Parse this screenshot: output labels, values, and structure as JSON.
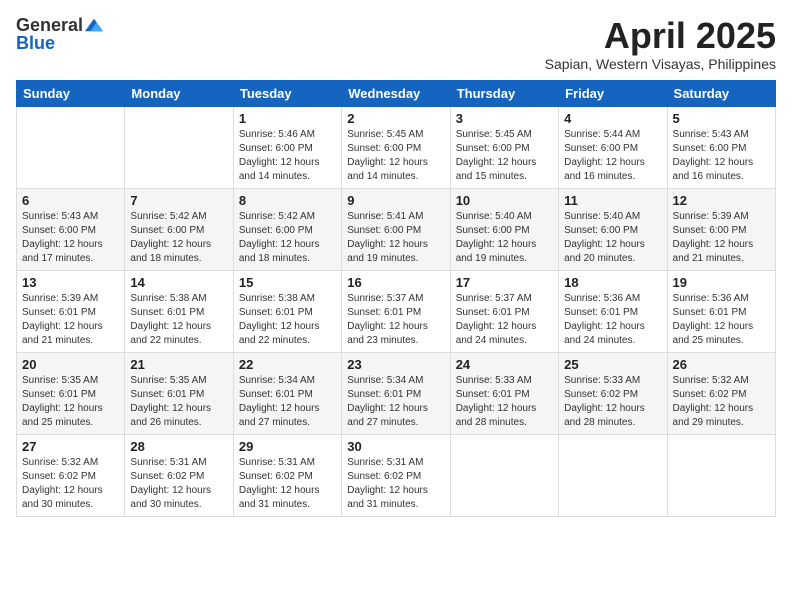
{
  "header": {
    "logo_general": "General",
    "logo_blue": "Blue",
    "month_title": "April 2025",
    "location": "Sapian, Western Visayas, Philippines"
  },
  "weekdays": [
    "Sunday",
    "Monday",
    "Tuesday",
    "Wednesday",
    "Thursday",
    "Friday",
    "Saturday"
  ],
  "weeks": [
    [
      {
        "day": "",
        "sunrise": "",
        "sunset": "",
        "daylight": ""
      },
      {
        "day": "",
        "sunrise": "",
        "sunset": "",
        "daylight": ""
      },
      {
        "day": "1",
        "sunrise": "Sunrise: 5:46 AM",
        "sunset": "Sunset: 6:00 PM",
        "daylight": "Daylight: 12 hours and 14 minutes."
      },
      {
        "day": "2",
        "sunrise": "Sunrise: 5:45 AM",
        "sunset": "Sunset: 6:00 PM",
        "daylight": "Daylight: 12 hours and 14 minutes."
      },
      {
        "day": "3",
        "sunrise": "Sunrise: 5:45 AM",
        "sunset": "Sunset: 6:00 PM",
        "daylight": "Daylight: 12 hours and 15 minutes."
      },
      {
        "day": "4",
        "sunrise": "Sunrise: 5:44 AM",
        "sunset": "Sunset: 6:00 PM",
        "daylight": "Daylight: 12 hours and 16 minutes."
      },
      {
        "day": "5",
        "sunrise": "Sunrise: 5:43 AM",
        "sunset": "Sunset: 6:00 PM",
        "daylight": "Daylight: 12 hours and 16 minutes."
      }
    ],
    [
      {
        "day": "6",
        "sunrise": "Sunrise: 5:43 AM",
        "sunset": "Sunset: 6:00 PM",
        "daylight": "Daylight: 12 hours and 17 minutes."
      },
      {
        "day": "7",
        "sunrise": "Sunrise: 5:42 AM",
        "sunset": "Sunset: 6:00 PM",
        "daylight": "Daylight: 12 hours and 18 minutes."
      },
      {
        "day": "8",
        "sunrise": "Sunrise: 5:42 AM",
        "sunset": "Sunset: 6:00 PM",
        "daylight": "Daylight: 12 hours and 18 minutes."
      },
      {
        "day": "9",
        "sunrise": "Sunrise: 5:41 AM",
        "sunset": "Sunset: 6:00 PM",
        "daylight": "Daylight: 12 hours and 19 minutes."
      },
      {
        "day": "10",
        "sunrise": "Sunrise: 5:40 AM",
        "sunset": "Sunset: 6:00 PM",
        "daylight": "Daylight: 12 hours and 19 minutes."
      },
      {
        "day": "11",
        "sunrise": "Sunrise: 5:40 AM",
        "sunset": "Sunset: 6:00 PM",
        "daylight": "Daylight: 12 hours and 20 minutes."
      },
      {
        "day": "12",
        "sunrise": "Sunrise: 5:39 AM",
        "sunset": "Sunset: 6:00 PM",
        "daylight": "Daylight: 12 hours and 21 minutes."
      }
    ],
    [
      {
        "day": "13",
        "sunrise": "Sunrise: 5:39 AM",
        "sunset": "Sunset: 6:01 PM",
        "daylight": "Daylight: 12 hours and 21 minutes."
      },
      {
        "day": "14",
        "sunrise": "Sunrise: 5:38 AM",
        "sunset": "Sunset: 6:01 PM",
        "daylight": "Daylight: 12 hours and 22 minutes."
      },
      {
        "day": "15",
        "sunrise": "Sunrise: 5:38 AM",
        "sunset": "Sunset: 6:01 PM",
        "daylight": "Daylight: 12 hours and 22 minutes."
      },
      {
        "day": "16",
        "sunrise": "Sunrise: 5:37 AM",
        "sunset": "Sunset: 6:01 PM",
        "daylight": "Daylight: 12 hours and 23 minutes."
      },
      {
        "day": "17",
        "sunrise": "Sunrise: 5:37 AM",
        "sunset": "Sunset: 6:01 PM",
        "daylight": "Daylight: 12 hours and 24 minutes."
      },
      {
        "day": "18",
        "sunrise": "Sunrise: 5:36 AM",
        "sunset": "Sunset: 6:01 PM",
        "daylight": "Daylight: 12 hours and 24 minutes."
      },
      {
        "day": "19",
        "sunrise": "Sunrise: 5:36 AM",
        "sunset": "Sunset: 6:01 PM",
        "daylight": "Daylight: 12 hours and 25 minutes."
      }
    ],
    [
      {
        "day": "20",
        "sunrise": "Sunrise: 5:35 AM",
        "sunset": "Sunset: 6:01 PM",
        "daylight": "Daylight: 12 hours and 25 minutes."
      },
      {
        "day": "21",
        "sunrise": "Sunrise: 5:35 AM",
        "sunset": "Sunset: 6:01 PM",
        "daylight": "Daylight: 12 hours and 26 minutes."
      },
      {
        "day": "22",
        "sunrise": "Sunrise: 5:34 AM",
        "sunset": "Sunset: 6:01 PM",
        "daylight": "Daylight: 12 hours and 27 minutes."
      },
      {
        "day": "23",
        "sunrise": "Sunrise: 5:34 AM",
        "sunset": "Sunset: 6:01 PM",
        "daylight": "Daylight: 12 hours and 27 minutes."
      },
      {
        "day": "24",
        "sunrise": "Sunrise: 5:33 AM",
        "sunset": "Sunset: 6:01 PM",
        "daylight": "Daylight: 12 hours and 28 minutes."
      },
      {
        "day": "25",
        "sunrise": "Sunrise: 5:33 AM",
        "sunset": "Sunset: 6:02 PM",
        "daylight": "Daylight: 12 hours and 28 minutes."
      },
      {
        "day": "26",
        "sunrise": "Sunrise: 5:32 AM",
        "sunset": "Sunset: 6:02 PM",
        "daylight": "Daylight: 12 hours and 29 minutes."
      }
    ],
    [
      {
        "day": "27",
        "sunrise": "Sunrise: 5:32 AM",
        "sunset": "Sunset: 6:02 PM",
        "daylight": "Daylight: 12 hours and 30 minutes."
      },
      {
        "day": "28",
        "sunrise": "Sunrise: 5:31 AM",
        "sunset": "Sunset: 6:02 PM",
        "daylight": "Daylight: 12 hours and 30 minutes."
      },
      {
        "day": "29",
        "sunrise": "Sunrise: 5:31 AM",
        "sunset": "Sunset: 6:02 PM",
        "daylight": "Daylight: 12 hours and 31 minutes."
      },
      {
        "day": "30",
        "sunrise": "Sunrise: 5:31 AM",
        "sunset": "Sunset: 6:02 PM",
        "daylight": "Daylight: 12 hours and 31 minutes."
      },
      {
        "day": "",
        "sunrise": "",
        "sunset": "",
        "daylight": ""
      },
      {
        "day": "",
        "sunrise": "",
        "sunset": "",
        "daylight": ""
      },
      {
        "day": "",
        "sunrise": "",
        "sunset": "",
        "daylight": ""
      }
    ]
  ]
}
